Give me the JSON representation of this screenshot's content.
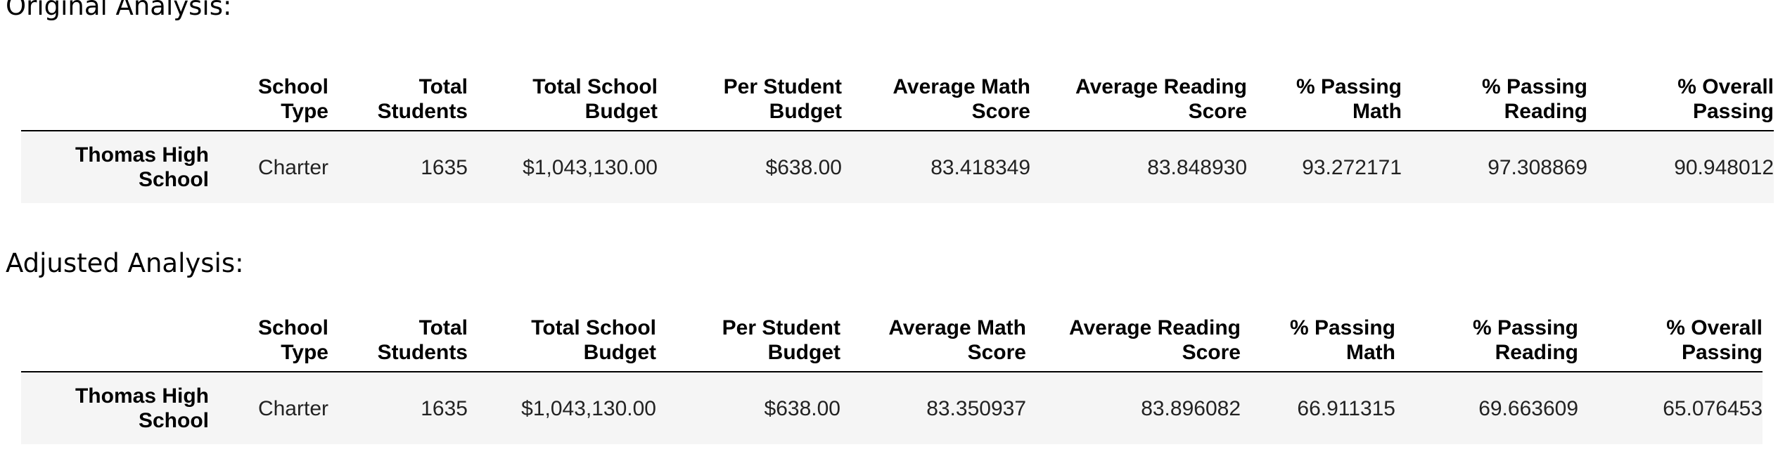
{
  "sections": [
    {
      "heading": "Original Analysis:",
      "columns": [
        "School Type",
        "Total Students",
        "Total School Budget",
        "Per Student Budget",
        "Average Math Score",
        "Average Reading Score",
        "% Passing Math",
        "% Passing Reading",
        "% Overall Passing"
      ],
      "column_lines": [
        [
          "School",
          "Type"
        ],
        [
          "Total",
          "Students"
        ],
        [
          "Total School",
          "Budget"
        ],
        [
          "Per Student",
          "Budget"
        ],
        [
          "Average Math",
          "Score"
        ],
        [
          "Average Reading",
          "Score"
        ],
        [
          "% Passing",
          "Math"
        ],
        [
          "% Passing",
          "Reading"
        ],
        [
          "% Overall",
          "Passing"
        ]
      ],
      "row": {
        "index_lines": [
          "Thomas High",
          "School"
        ],
        "values": [
          "Charter",
          "1635",
          "$1,043,130.00",
          "$638.00",
          "83.418349",
          "83.848930",
          "93.272171",
          "97.308869",
          "90.948012"
        ]
      }
    },
    {
      "heading": "Adjusted Analysis:",
      "columns": [
        "School Type",
        "Total Students",
        "Total School Budget",
        "Per Student Budget",
        "Average Math Score",
        "Average Reading Score",
        "% Passing Math",
        "% Passing Reading",
        "% Overall Passing"
      ],
      "column_lines": [
        [
          "School",
          "Type"
        ],
        [
          "Total",
          "Students"
        ],
        [
          "Total School",
          "Budget"
        ],
        [
          "Per Student",
          "Budget"
        ],
        [
          "Average Math",
          "Score"
        ],
        [
          "Average Reading",
          "Score"
        ],
        [
          "% Passing",
          "Math"
        ],
        [
          "% Passing",
          "Reading"
        ],
        [
          "% Overall",
          "Passing"
        ]
      ],
      "row": {
        "index_lines": [
          "Thomas High",
          "School"
        ],
        "values": [
          "Charter",
          "1635",
          "$1,043,130.00",
          "$638.00",
          "83.350937",
          "83.896082",
          "66.911315",
          "69.663609",
          "65.076453"
        ]
      }
    }
  ]
}
